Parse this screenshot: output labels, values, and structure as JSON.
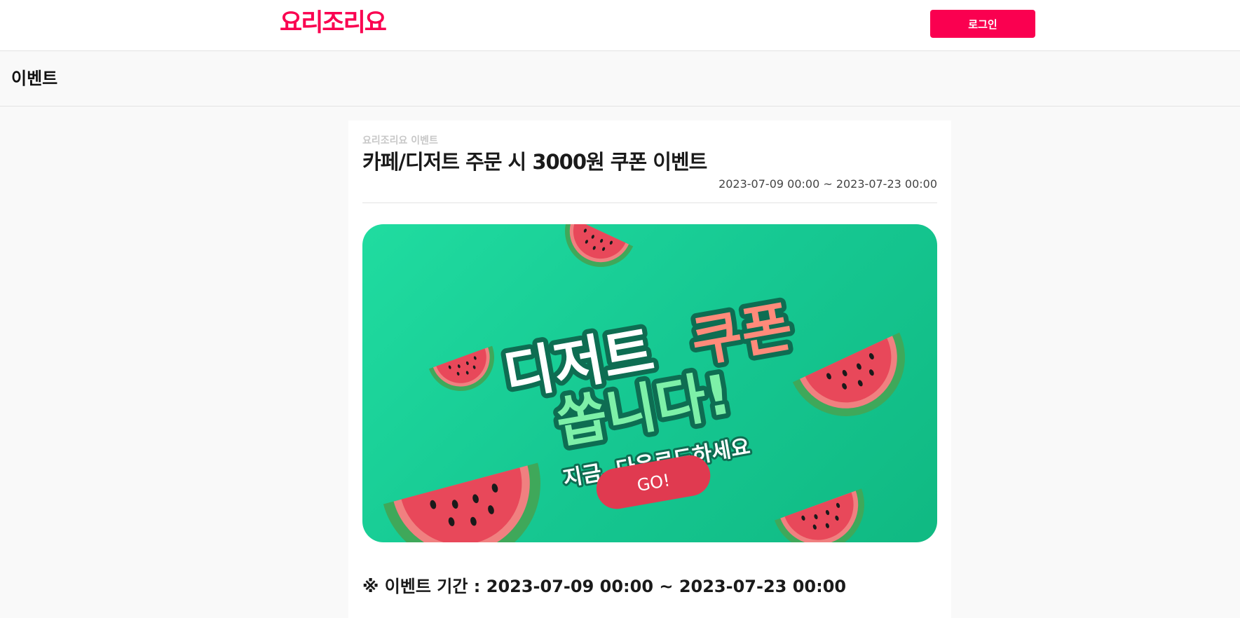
{
  "header": {
    "logo_text": "요리조리요",
    "login_label": "로그인",
    "brand_color": "#fa0050"
  },
  "subheader": {
    "title": "이벤트"
  },
  "event": {
    "category": "요리조리요 이벤트",
    "title": "카페/디저트 주문 시 3000원 쿠폰 이벤트",
    "period": "2023-07-09 00:00 ~ 2023-07-23 00:00",
    "banner": {
      "headline_part1": "디저트",
      "headline_part2": "쿠폰",
      "headline_line2": "쏩니다!",
      "subline": "지금, 다운로드하세요",
      "button_label": "GO!",
      "background_color": "#1ccf98",
      "icon": "watermelon-icon"
    },
    "period_label": "※ 이벤트 기간 : 2023-07-09 00:00 ~ 2023-07-23 00:00"
  }
}
